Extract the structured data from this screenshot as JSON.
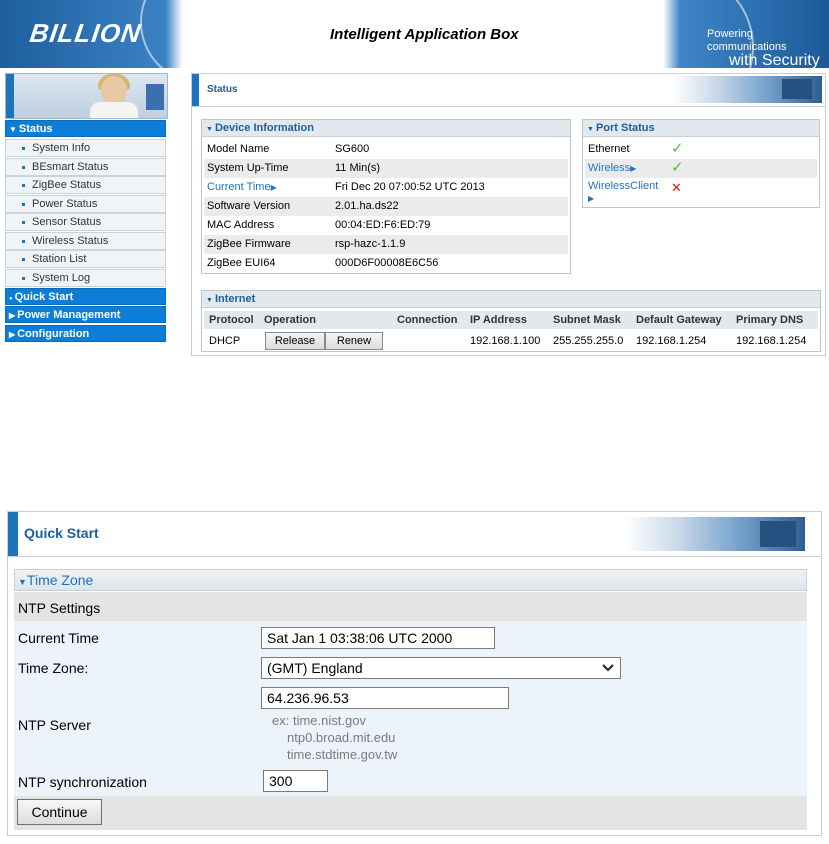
{
  "header": {
    "logo": "BILLION",
    "app_title": "Intelligent Application Box",
    "brand_line1": "Powering communications",
    "brand_line2": "with Security"
  },
  "sidebar": {
    "status_label": "Status",
    "status_items": [
      {
        "label": "System Info"
      },
      {
        "label": "BEsmart Status"
      },
      {
        "label": "ZigBee Status"
      },
      {
        "label": "Power Status"
      },
      {
        "label": "Sensor Status"
      },
      {
        "label": "Wireless Status"
      },
      {
        "label": "Station List"
      },
      {
        "label": "System Log"
      }
    ],
    "quick_start_label": "Quick Start",
    "power_mgmt_label": "Power Management",
    "configuration_label": "Configuration"
  },
  "status_page": {
    "title": "Status",
    "device_info": {
      "title": "Device Information",
      "rows": [
        {
          "label": "Model Name",
          "value": "SG600"
        },
        {
          "label": "System Up-Time",
          "value": "11 Min(s)"
        },
        {
          "label": "Current Time",
          "value": "Fri Dec 20 07:00:52 UTC 2013"
        },
        {
          "label": "Software Version",
          "value": "2.01.ha.ds22"
        },
        {
          "label": "MAC Address",
          "value": "00:04:ED:F6:ED:79"
        },
        {
          "label": "ZigBee Firmware",
          "value": "rsp-hazc-1.1.9"
        },
        {
          "label": "ZigBee EUI64",
          "value": "000D6F00008E6C56"
        }
      ]
    },
    "port_status": {
      "title": "Port Status",
      "ports": [
        {
          "label": "Ethernet",
          "state": "ok"
        },
        {
          "label": "Wireless",
          "state": "ok"
        },
        {
          "label": "WirelessClient",
          "state": "fail"
        }
      ]
    },
    "internet": {
      "title": "Internet",
      "headers": [
        "Protocol",
        "Operation",
        "Connection",
        "IP Address",
        "Subnet Mask",
        "Default Gateway",
        "Primary DNS"
      ],
      "row": {
        "protocol": "DHCP",
        "release_label": "Release",
        "renew_label": "Renew",
        "connection": "",
        "ip": "192.168.1.100",
        "mask": "255.255.255.0",
        "gateway": "192.168.1.254",
        "dns": "192.168.1.254"
      }
    }
  },
  "quick_start": {
    "title": "Quick Start",
    "section_title": "Time Zone",
    "ntp_settings_label": "NTP Settings",
    "current_time_label": "Current Time",
    "current_time_value": "Sat Jan  1 03:38:06 UTC 2000",
    "time_zone_label": "Time Zone:",
    "time_zone_value": "(GMT) England",
    "ntp_server_label": "NTP Server",
    "ntp_server_value": "64.236.96.53",
    "hint1": "ex: time.nist.gov",
    "hint2": "ntp0.broad.mit.edu",
    "hint3": "time.stdtime.gov.tw",
    "ntp_sync_label": "NTP synchronization",
    "ntp_sync_value": "300",
    "continue_label": "Continue"
  },
  "colors": {
    "accent": "#1e73be",
    "nav_active": "#0c7ed8",
    "ok": "#5fb84a",
    "fail": "#d82020"
  }
}
